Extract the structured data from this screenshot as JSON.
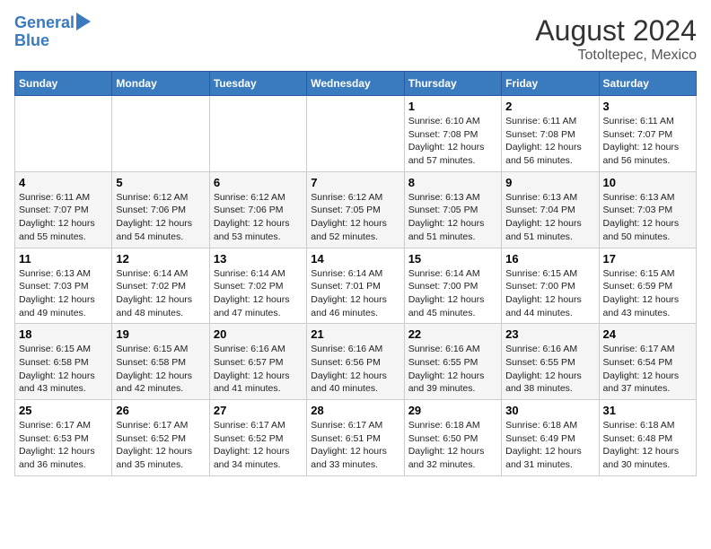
{
  "header": {
    "logo_line1": "General",
    "logo_line2": "Blue",
    "month": "August 2024",
    "location": "Totoltepec, Mexico"
  },
  "days_of_week": [
    "Sunday",
    "Monday",
    "Tuesday",
    "Wednesday",
    "Thursday",
    "Friday",
    "Saturday"
  ],
  "weeks": [
    {
      "days": [
        {
          "num": "",
          "info": ""
        },
        {
          "num": "",
          "info": ""
        },
        {
          "num": "",
          "info": ""
        },
        {
          "num": "",
          "info": ""
        },
        {
          "num": "1",
          "info": "Sunrise: 6:10 AM\nSunset: 7:08 PM\nDaylight: 12 hours\nand 57 minutes."
        },
        {
          "num": "2",
          "info": "Sunrise: 6:11 AM\nSunset: 7:08 PM\nDaylight: 12 hours\nand 56 minutes."
        },
        {
          "num": "3",
          "info": "Sunrise: 6:11 AM\nSunset: 7:07 PM\nDaylight: 12 hours\nand 56 minutes."
        }
      ]
    },
    {
      "days": [
        {
          "num": "4",
          "info": "Sunrise: 6:11 AM\nSunset: 7:07 PM\nDaylight: 12 hours\nand 55 minutes."
        },
        {
          "num": "5",
          "info": "Sunrise: 6:12 AM\nSunset: 7:06 PM\nDaylight: 12 hours\nand 54 minutes."
        },
        {
          "num": "6",
          "info": "Sunrise: 6:12 AM\nSunset: 7:06 PM\nDaylight: 12 hours\nand 53 minutes."
        },
        {
          "num": "7",
          "info": "Sunrise: 6:12 AM\nSunset: 7:05 PM\nDaylight: 12 hours\nand 52 minutes."
        },
        {
          "num": "8",
          "info": "Sunrise: 6:13 AM\nSunset: 7:05 PM\nDaylight: 12 hours\nand 51 minutes."
        },
        {
          "num": "9",
          "info": "Sunrise: 6:13 AM\nSunset: 7:04 PM\nDaylight: 12 hours\nand 51 minutes."
        },
        {
          "num": "10",
          "info": "Sunrise: 6:13 AM\nSunset: 7:03 PM\nDaylight: 12 hours\nand 50 minutes."
        }
      ]
    },
    {
      "days": [
        {
          "num": "11",
          "info": "Sunrise: 6:13 AM\nSunset: 7:03 PM\nDaylight: 12 hours\nand 49 minutes."
        },
        {
          "num": "12",
          "info": "Sunrise: 6:14 AM\nSunset: 7:02 PM\nDaylight: 12 hours\nand 48 minutes."
        },
        {
          "num": "13",
          "info": "Sunrise: 6:14 AM\nSunset: 7:02 PM\nDaylight: 12 hours\nand 47 minutes."
        },
        {
          "num": "14",
          "info": "Sunrise: 6:14 AM\nSunset: 7:01 PM\nDaylight: 12 hours\nand 46 minutes."
        },
        {
          "num": "15",
          "info": "Sunrise: 6:14 AM\nSunset: 7:00 PM\nDaylight: 12 hours\nand 45 minutes."
        },
        {
          "num": "16",
          "info": "Sunrise: 6:15 AM\nSunset: 7:00 PM\nDaylight: 12 hours\nand 44 minutes."
        },
        {
          "num": "17",
          "info": "Sunrise: 6:15 AM\nSunset: 6:59 PM\nDaylight: 12 hours\nand 43 minutes."
        }
      ]
    },
    {
      "days": [
        {
          "num": "18",
          "info": "Sunrise: 6:15 AM\nSunset: 6:58 PM\nDaylight: 12 hours\nand 43 minutes."
        },
        {
          "num": "19",
          "info": "Sunrise: 6:15 AM\nSunset: 6:58 PM\nDaylight: 12 hours\nand 42 minutes."
        },
        {
          "num": "20",
          "info": "Sunrise: 6:16 AM\nSunset: 6:57 PM\nDaylight: 12 hours\nand 41 minutes."
        },
        {
          "num": "21",
          "info": "Sunrise: 6:16 AM\nSunset: 6:56 PM\nDaylight: 12 hours\nand 40 minutes."
        },
        {
          "num": "22",
          "info": "Sunrise: 6:16 AM\nSunset: 6:55 PM\nDaylight: 12 hours\nand 39 minutes."
        },
        {
          "num": "23",
          "info": "Sunrise: 6:16 AM\nSunset: 6:55 PM\nDaylight: 12 hours\nand 38 minutes."
        },
        {
          "num": "24",
          "info": "Sunrise: 6:17 AM\nSunset: 6:54 PM\nDaylight: 12 hours\nand 37 minutes."
        }
      ]
    },
    {
      "days": [
        {
          "num": "25",
          "info": "Sunrise: 6:17 AM\nSunset: 6:53 PM\nDaylight: 12 hours\nand 36 minutes."
        },
        {
          "num": "26",
          "info": "Sunrise: 6:17 AM\nSunset: 6:52 PM\nDaylight: 12 hours\nand 35 minutes."
        },
        {
          "num": "27",
          "info": "Sunrise: 6:17 AM\nSunset: 6:52 PM\nDaylight: 12 hours\nand 34 minutes."
        },
        {
          "num": "28",
          "info": "Sunrise: 6:17 AM\nSunset: 6:51 PM\nDaylight: 12 hours\nand 33 minutes."
        },
        {
          "num": "29",
          "info": "Sunrise: 6:18 AM\nSunset: 6:50 PM\nDaylight: 12 hours\nand 32 minutes."
        },
        {
          "num": "30",
          "info": "Sunrise: 6:18 AM\nSunset: 6:49 PM\nDaylight: 12 hours\nand 31 minutes."
        },
        {
          "num": "31",
          "info": "Sunrise: 6:18 AM\nSunset: 6:48 PM\nDaylight: 12 hours\nand 30 minutes."
        }
      ]
    }
  ]
}
